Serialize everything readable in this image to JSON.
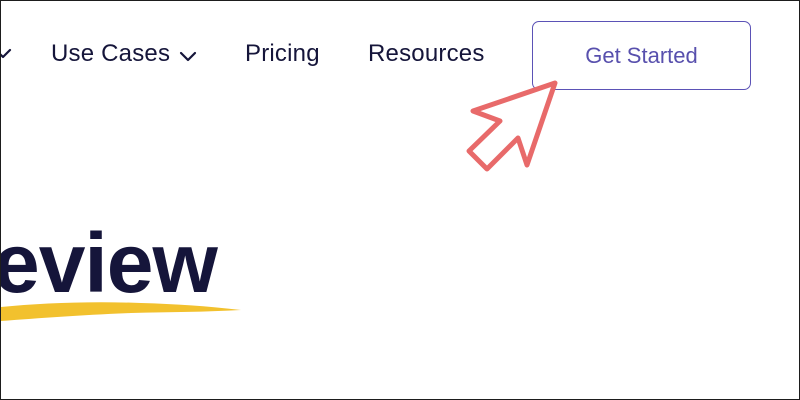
{
  "nav": {
    "items": [
      {
        "label": "Use Cases",
        "has_dropdown": true
      },
      {
        "label": "Pricing"
      },
      {
        "label": "Resources"
      }
    ],
    "cta_label": "Get Started"
  },
  "hero": {
    "partial_word": "eview"
  },
  "icons": {
    "left_edge": "chevron-down-icon",
    "dropdown": "chevron-down-icon",
    "pointer": "arrow-pointer-icon"
  },
  "colors": {
    "text": "#15153a",
    "cta_border": "#5b52b6",
    "cta_text": "#5850ad",
    "arrow": "#e86a6a",
    "highlight": "#f2c12e"
  }
}
